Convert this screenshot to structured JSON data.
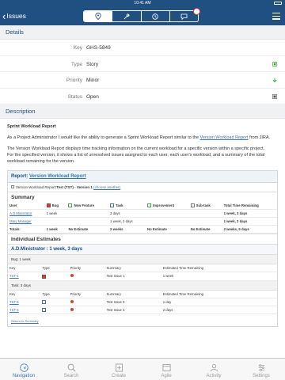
{
  "status_bar": {
    "time": "10:41 AM"
  },
  "nav": {
    "back_label": "Issues",
    "segments": [
      "location-icon",
      "wrench-icon",
      "clock-icon",
      "comment-icon"
    ]
  },
  "details": {
    "header": "Details",
    "fields": [
      {
        "label": "Key",
        "value": "GHS-5849"
      },
      {
        "label": "Type",
        "value": "Story",
        "icon": "story-icon"
      },
      {
        "label": "Priority",
        "value": "Minor",
        "icon": "arrow-down-icon"
      },
      {
        "label": "Status",
        "value": "Open",
        "icon": "open-status-icon"
      }
    ]
  },
  "description": {
    "header": "Description",
    "title": "Sprint Workload Report",
    "p1_a": "As a Project Administrator I would like the ability to generate a Sprint Workload Report similar to the ",
    "p1_link": "Version Workload Report",
    "p1_b": " from JIRA.",
    "p2": "The Version Workload Report displays time tracking information on the current workload for a specific version within a specific project.",
    "p3": "For the specified version, it shows a list of unresolved issues assigned to each user, each user's workload, and a summary of the total workload remaining for the version."
  },
  "report": {
    "title_prefix": "Report: ",
    "title_link": "Version Workload Report",
    "sub_label": "Version Workload Report: ",
    "sub_bold": "Test (TST) - Version 1",
    "sub_link": "(choose another)",
    "summary_heading": "Summary",
    "summary_columns": [
      "User",
      "Bug",
      "New Feature",
      "Task",
      "Improvement",
      "Sub-task",
      "Total Time Remaining"
    ],
    "summary_rows": [
      {
        "user": "A.D.Ministrator",
        "bug": "1 week",
        "new_feature": "",
        "task": "3 days",
        "improvement": "",
        "subtask": "",
        "total": "1 week, 3 days"
      },
      {
        "user": "Mary Manager",
        "bug": "",
        "new_feature": "",
        "task": "1 week, 2 days",
        "improvement": "",
        "subtask": "",
        "total": "1 week, 2 days"
      }
    ],
    "totals_row": {
      "label": "Totals:",
      "bug": "1 week",
      "new_feature": "No Estimate",
      "task": "2 weeks",
      "improvement": "No Estimate",
      "subtask": "No Estimate",
      "total": "2 weeks, 5 days"
    },
    "individual_heading": "Individual Estimates",
    "person_heading": "A.D.Ministrator : 1 week, 3 days",
    "groups": [
      {
        "label": "Bug: 1 week",
        "columns": [
          "Key",
          "Type",
          "Priority",
          "Summary",
          "Estimated Time Remaining"
        ],
        "rows": [
          {
            "key": "TST-1",
            "summary": "Test Issue 1",
            "remaining": "1 week"
          }
        ]
      },
      {
        "label": "Task: 3 days",
        "columns": [
          "Key",
          "Type",
          "Priority",
          "Summary",
          "Estimated Time Remaining"
        ],
        "rows": [
          {
            "key": "TST-5",
            "summary": "Test Issue 5",
            "remaining": "1 day"
          },
          {
            "key": "TST-4",
            "summary": "Test Issue 4",
            "remaining": "2 days"
          }
        ]
      }
    ],
    "return_link": "Return to Summary"
  },
  "tabs": [
    {
      "label": "Navigation",
      "icon": "navigation-icon",
      "active": true
    },
    {
      "label": "Search",
      "icon": "search-icon",
      "active": false
    },
    {
      "label": "Create",
      "icon": "create-icon",
      "active": false
    },
    {
      "label": "Agile",
      "icon": "agile-icon",
      "active": false
    },
    {
      "label": "Activity",
      "icon": "activity-icon",
      "active": false
    },
    {
      "label": "Settings",
      "icon": "settings-icon",
      "active": false
    }
  ],
  "colors": {
    "brand": "#205081",
    "link": "#3b73af",
    "alert": "#d04437"
  }
}
